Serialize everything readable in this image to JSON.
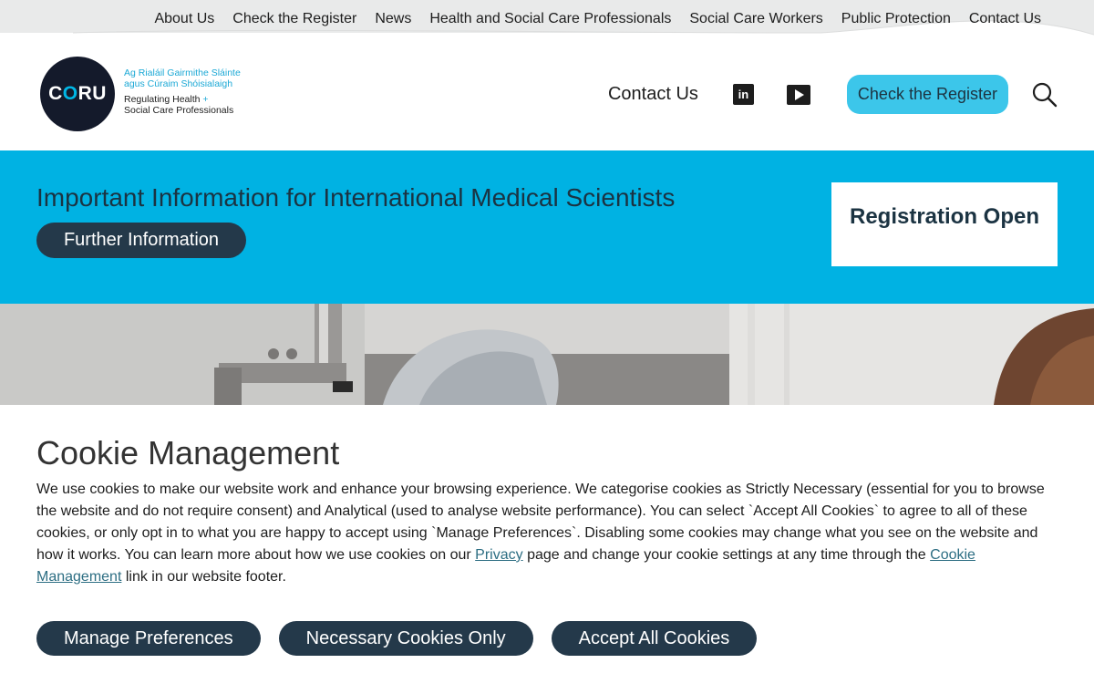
{
  "topnav": {
    "items": [
      "About Us",
      "Check the Register",
      "News",
      "Health and Social Care Professionals",
      "Social Care Workers",
      "Public Protection",
      "Contact Us"
    ]
  },
  "logo": {
    "mark_c": "C",
    "mark_o": "O",
    "mark_ru": "RU",
    "irish_line1": "Ag Rialáil Gairmithe Sláinte",
    "irish_line2": "agus Cúraim Shóisialaigh",
    "eng_line1": "Regulating Health",
    "eng_plus": "+",
    "eng_line2": "Social Care Professionals"
  },
  "header": {
    "contact_label": "Contact Us",
    "linkedin_icon": "linkedin-icon",
    "linkedin_glyph": "in",
    "youtube_icon": "youtube-icon",
    "register_label": "Check the Register",
    "search_icon": "search-icon"
  },
  "banner": {
    "title": "Important Information for International Medical Scientists",
    "button_label": "Further Information",
    "registration_label": "Registration Open"
  },
  "cookie": {
    "title": "Cookie Management",
    "text_before_privacy": "We use cookies to make our website work and enhance your browsing experience. We categorise cookies as Strictly Necessary (essential for you to browse the website and do not require consent) and Analytical (used to analyse website performance). You can select `Accept All Cookies` to agree to all of these cookies, or only opt in to what you are happy to accept using `Manage Preferences`. Disabling some cookies may change what you see on the website and how it works. You can learn more about how we use cookies on our ",
    "privacy_link": "Privacy",
    "text_middle": " page and change your cookie settings at any time through the ",
    "cookie_mgmt_link": "Cookie Management",
    "text_after": " link in our website footer.",
    "buttons": {
      "manage": "Manage Preferences",
      "necessary": "Necessary Cookies Only",
      "accept": "Accept All Cookies"
    }
  },
  "colors": {
    "banner_bg": "#00b2e3",
    "button_dark": "#24394a",
    "register_btn": "#3cc6ea",
    "logo_dark": "#141a2b",
    "logo_accent": "#00b6e5"
  }
}
